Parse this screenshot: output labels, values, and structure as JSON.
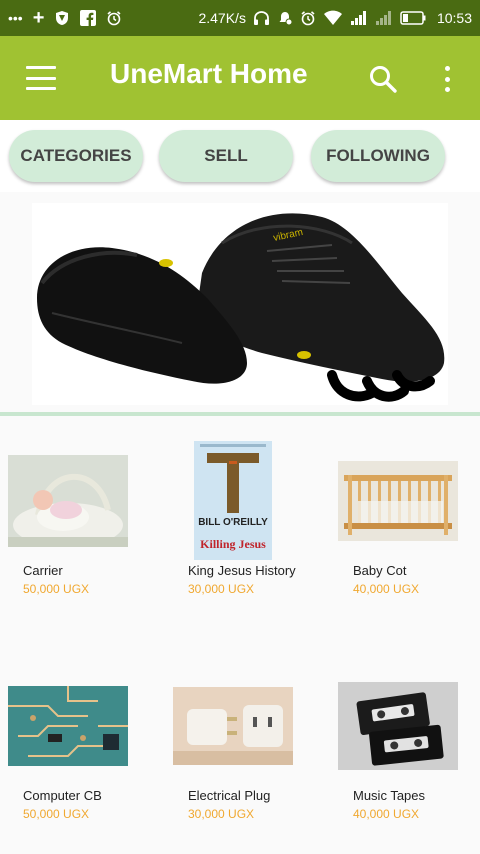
{
  "status_bar": {
    "left_icons": [
      "overflow-dots-icon",
      "plus-icon",
      "shield-icon",
      "facebook-icon",
      "alarm-icon"
    ],
    "speed": "2.47K/s",
    "right_icons": [
      "headphones-icon",
      "dnd-icon",
      "alarm-icon",
      "wifi-icon",
      "signal-icon",
      "signal-icon",
      "battery-icon"
    ],
    "time": "10:53"
  },
  "app_bar": {
    "title": "UneMart Home",
    "background": "#a0c232"
  },
  "tabs": [
    {
      "label": "CATEGORIES"
    },
    {
      "label": "SELL"
    },
    {
      "label": "FOLLOWING"
    }
  ],
  "banner": {
    "image": "black-toe-shoes-image"
  },
  "products": [
    {
      "name": "Carrier",
      "price": "50,000 UGX",
      "image": "baby-in-basket-image"
    },
    {
      "name": "King Jesus History",
      "price": "30,000 UGX",
      "image": "killing-jesus-book-image",
      "book_author": "BILL O'REILLY",
      "book_title": "Killing Jesus"
    },
    {
      "name": "Baby Cot",
      "price": "40,000 UGX",
      "image": "wooden-crib-image"
    },
    {
      "name": "Computer CB",
      "price": "50,000 UGX",
      "image": "circuit-board-image"
    },
    {
      "name": "Electrical Plug",
      "price": "30,000 UGX",
      "image": "plug-adapter-image"
    },
    {
      "name": "Music Tapes",
      "price": "40,000 UGX",
      "image": "cassette-tapes-image"
    }
  ],
  "colors": {
    "status_bar": "#4a6b12",
    "accent": "#a0c232",
    "tab_pill": "#d2ecd8",
    "price": "#f0a830"
  }
}
